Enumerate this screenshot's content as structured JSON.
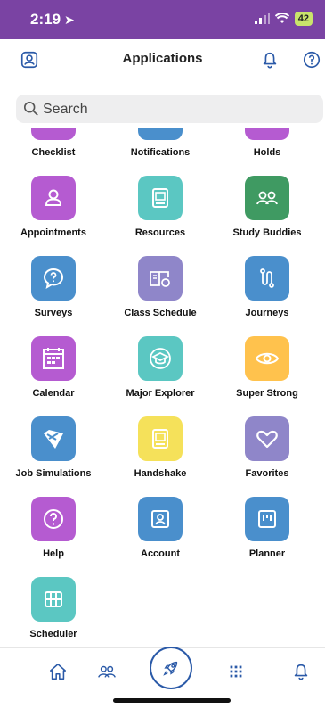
{
  "status_bar": {
    "time": "2:19",
    "battery": "42"
  },
  "header": {
    "title": "Applications"
  },
  "search": {
    "placeholder": "Search"
  },
  "apps": [
    {
      "label": "Checklist",
      "color": "#b55bd1",
      "icon": "checklist-icon"
    },
    {
      "label": "Notifications",
      "color": "#4a8fcc",
      "icon": "bell-icon"
    },
    {
      "label": "Holds",
      "color": "#b55bd1",
      "icon": "hold-icon"
    },
    {
      "label": "Appointments",
      "color": "#b55bd1",
      "icon": "person-icon"
    },
    {
      "label": "Resources",
      "color": "#5bc7c2",
      "icon": "book-icon"
    },
    {
      "label": "Study Buddies",
      "color": "#3f9a62",
      "icon": "buddies-icon"
    },
    {
      "label": "Surveys",
      "color": "#4a8fcc",
      "icon": "speech-question-icon"
    },
    {
      "label": "Class Schedule",
      "color": "#8f86c9",
      "icon": "open-book-icon"
    },
    {
      "label": "Journeys",
      "color": "#4a8fcc",
      "icon": "path-icon"
    },
    {
      "label": "Calendar",
      "color": "#b55bd1",
      "icon": "calendar-icon"
    },
    {
      "label": "Major Explorer",
      "color": "#5bc7c2",
      "icon": "graduation-cap-icon"
    },
    {
      "label": "Super Strong",
      "color": "#ffc24d",
      "icon": "eye-icon"
    },
    {
      "label": "Job Simulations",
      "color": "#4a8fcc",
      "icon": "jobsim-logo-icon"
    },
    {
      "label": "Handshake",
      "color": "#f5e15a",
      "icon": "book-icon"
    },
    {
      "label": "Favorites",
      "color": "#8f86c9",
      "icon": "heart-icon"
    },
    {
      "label": "Help",
      "color": "#b55bd1",
      "icon": "question-circle-icon"
    },
    {
      "label": "Account",
      "color": "#4a8fcc",
      "icon": "account-icon"
    },
    {
      "label": "Planner",
      "color": "#4a8fcc",
      "icon": "planner-icon"
    },
    {
      "label": "Scheduler",
      "color": "#5bc7c2",
      "icon": "grid-icon"
    }
  ],
  "colors": {
    "accent": "#7a43a3",
    "nav_blue": "#2b5aa8"
  }
}
